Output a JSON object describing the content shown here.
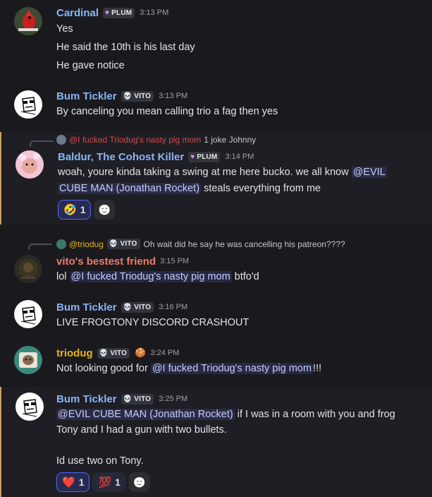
{
  "messages": [
    {
      "user": "Cardinal",
      "user_color": "#8ab4f8",
      "tag_icon": "♥",
      "tag": "PLUM",
      "tag_icon_color": "#d59cf0",
      "time": "3:13 PM",
      "lines": [
        "Yes",
        "He said the 10th is his last day",
        "He gave notice"
      ]
    },
    {
      "user": "Bum Tickler",
      "user_color": "#8ab4f8",
      "tag_icon": "💀",
      "tag": "VITO",
      "time": "3:13 PM",
      "lines": [
        "By canceling you mean calling trio a fag then yes"
      ]
    },
    {
      "reply": {
        "mention": "@I fucked Triodug's nasty pig mom",
        "text": "1 joke Johnny",
        "mention_color": "#d14a4a"
      },
      "user": "Baldur, The Cohost Killer",
      "user_color": "#8ab4f8",
      "tag_icon": "♥",
      "tag": "PLUM",
      "tag_icon_color": "#d59cf0",
      "time": "3:14 PM",
      "line1_text": "woah, youre kinda taking a swing at me here bucko. we all know ",
      "line1_mention": "@EVIL",
      "line2_mention": "CUBE MAN (Jonathan Rocket)",
      "line2_text": " steals everything from me",
      "reactions": [
        {
          "emoji": "🤣",
          "count": "1",
          "me": true
        }
      ]
    },
    {
      "reply": {
        "mention": "@triodug",
        "tag_icon": "💀",
        "tag": "VITO",
        "text": "Oh wait did he say he was cancelling his patreon????",
        "mention_color": "#eab30c"
      },
      "user": "vito's bestest friend",
      "user_color": "#f07a6a",
      "time": "3:15 PM",
      "pre": "lol ",
      "mention": "@I fucked Triodug's nasty pig mom",
      "post": " btfo'd"
    },
    {
      "user": "Bum Tickler",
      "user_color": "#8ab4f8",
      "tag_icon": "💀",
      "tag": "VITO",
      "time": "3:16 PM",
      "lines": [
        "LIVE FROGTONY DISCORD CRASHOUT"
      ]
    },
    {
      "user": "triodug",
      "user_color": "#eab30c",
      "tag_icon": "💀",
      "tag": "VITO",
      "extra_badge": "🍪",
      "time": "3:24 PM",
      "pre": "Not looking good for ",
      "mention": "@I fucked Triodug's nasty pig mom",
      "post": "!!!"
    },
    {
      "user": "Bum Tickler",
      "user_color": "#8ab4f8",
      "tag_icon": "💀",
      "tag": "VITO",
      "time": "3:25 PM",
      "line1_mention": "@EVIL CUBE MAN (Jonathan Rocket)",
      "line1_text": " if I was in a room with you and frog",
      "line2_text": "Tony and I had a gun with two bullets.",
      "line3_text": "Id use two on Tony.",
      "reactions": [
        {
          "emoji": "❤️",
          "count": "1",
          "me": true
        },
        {
          "emoji": "💯",
          "count": "1",
          "me": false
        }
      ]
    }
  ],
  "add_reaction_icon": "😊"
}
